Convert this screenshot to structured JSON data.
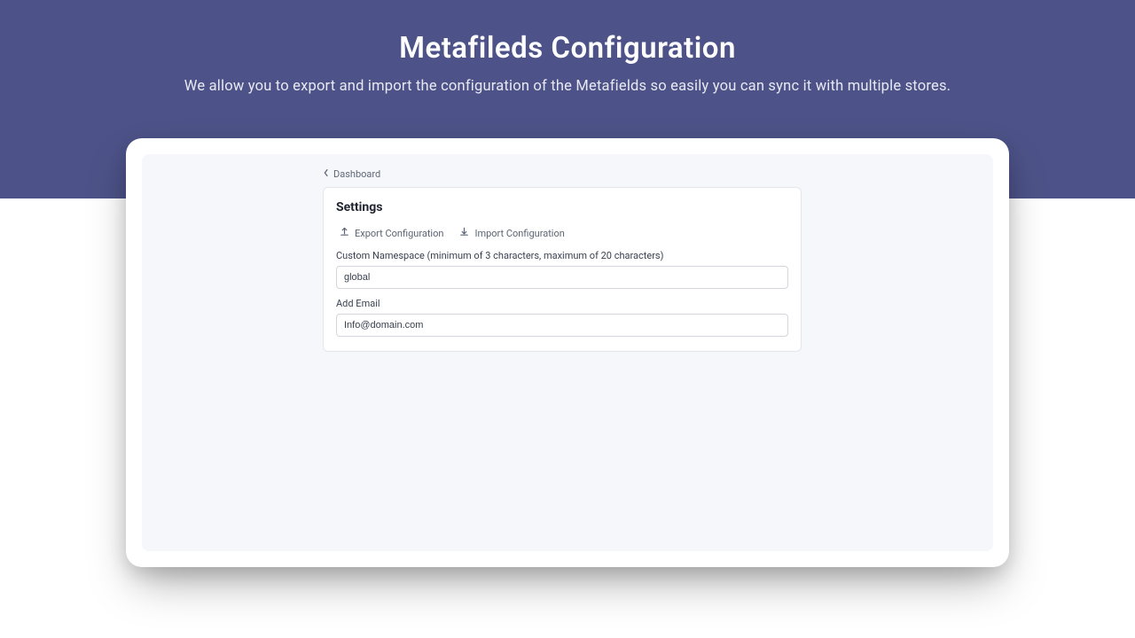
{
  "hero": {
    "title": "Metafileds Configuration",
    "subtitle": "We allow you to export and import the configuration of the Metafields so easily you can sync it with multiple stores."
  },
  "breadcrumb": {
    "label": "Dashboard"
  },
  "settings": {
    "title": "Settings",
    "export_label": "Export Configuration",
    "import_label": "Import Configuration",
    "namespace": {
      "label": "Custom Namespace (minimum of 3 characters, maximum of 20 characters)",
      "value": "global"
    },
    "email": {
      "label": "Add Email",
      "value": "Info@domain.com"
    }
  }
}
